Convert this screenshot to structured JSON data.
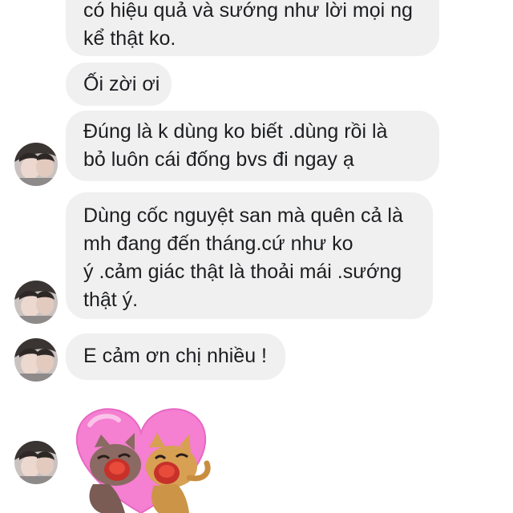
{
  "conversation": {
    "messages": [
      {
        "lines": [
          "có hiệu quả và sướng như lời mọi ng",
          "kể thật ko."
        ]
      },
      {
        "lines": [
          "Ối zời ơi"
        ]
      },
      {
        "lines": [
          "Đúng là k dùng ko biết .dùng rồi là",
          "bỏ luôn cái đống bvs đi ngay ạ"
        ]
      },
      {
        "lines": [
          "Dùng cốc nguyệt san mà quên cả là",
          "mh đang đến tháng.cứ như ko",
          "ý .cảm giác thật là thoải mái .sướng",
          "thật ý."
        ]
      },
      {
        "lines": [
          "E cảm ơn chị nhiều !"
        ]
      }
    ],
    "sticker": {
      "icon": "kissing-cats-heart-sticker",
      "colors": {
        "heart": "#f57fd0",
        "cat_left": "#8a6a62",
        "cat_right": "#d8a052"
      }
    }
  },
  "colors": {
    "bubble_background": "#f1f0f0",
    "text": "#1c1e21",
    "background": "#ffffff"
  }
}
